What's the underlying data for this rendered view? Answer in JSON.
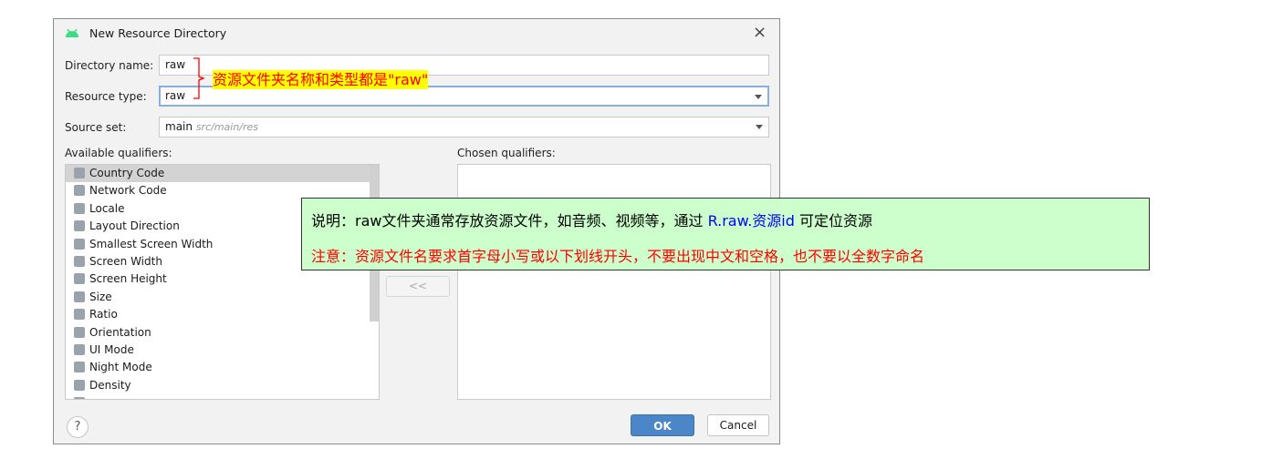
{
  "dialog": {
    "title": "New Resource Directory",
    "directory_name": {
      "label": "Directory name:",
      "value": "raw"
    },
    "resource_type": {
      "label": "Resource type:",
      "value": "raw"
    },
    "source_set": {
      "label": "Source set:",
      "value": "main",
      "path": "src/main/res"
    },
    "available_label": "Available qualifiers:",
    "chosen_label": "Chosen qualifiers:",
    "qualifiers": [
      {
        "label": "Country Code",
        "icon": "sim-card-icon",
        "selected": true
      },
      {
        "label": "Network Code",
        "icon": "sim-network-icon"
      },
      {
        "label": "Locale",
        "icon": "globe-icon"
      },
      {
        "label": "Layout Direction",
        "icon": "layout-direction-icon"
      },
      {
        "label": "Smallest Screen Width",
        "icon": "smallest-width-icon"
      },
      {
        "label": "Screen Width",
        "icon": "screen-width-icon"
      },
      {
        "label": "Screen Height",
        "icon": "screen-height-icon"
      },
      {
        "label": "Size",
        "icon": "size-icon"
      },
      {
        "label": "Ratio",
        "icon": "ratio-icon"
      },
      {
        "label": "Orientation",
        "icon": "orientation-icon"
      },
      {
        "label": "UI Mode",
        "icon": "ui-mode-icon"
      },
      {
        "label": "Night Mode",
        "icon": "night-mode-icon"
      },
      {
        "label": "Density",
        "icon": "density-icon"
      }
    ],
    "remove_button": "<<",
    "help_button": "?",
    "ok_button": "OK",
    "cancel_button": "Cancel",
    "close_button": "×"
  },
  "annotation": {
    "text": "资源文件夹名称和类型都是\"raw\""
  },
  "note": {
    "line1_prefix": "说明：raw文件夹通常存放资源文件，如音频、视频等，通过 ",
    "line1_highlight": "R.raw.资源id",
    "line1_suffix": " 可定位资源",
    "line2": "注意：资源文件名要求首字母小写或以下划线开头，不要出现中文和空格，也不要以全数字命名"
  },
  "colors": {
    "accent": "#4a86c8",
    "note_bg": "#ccffcc",
    "note_red": "#ff0000",
    "note_blue": "#0000ff",
    "annotation_bg": "#ffff00"
  }
}
